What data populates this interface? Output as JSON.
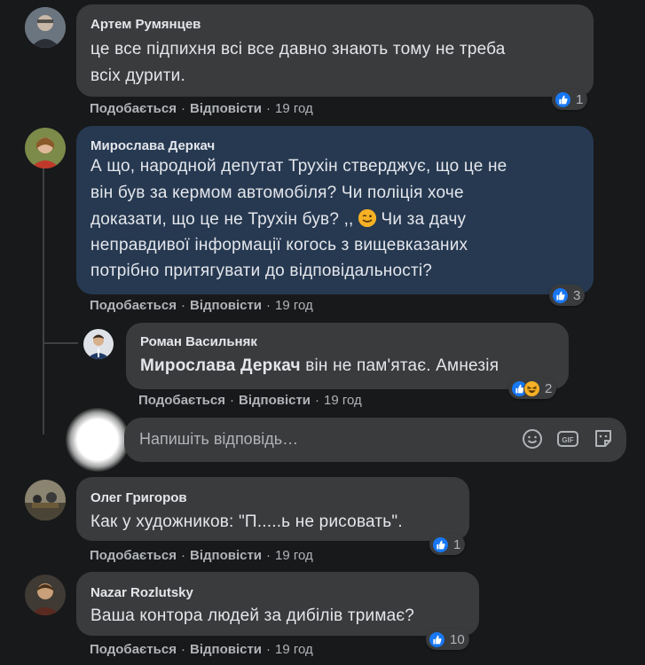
{
  "comments": [
    {
      "author": "Артем Румянцев",
      "text_lines": [
        "це все підпихня всі все давно знають тому не треба",
        "всіх дурити."
      ],
      "reaction_count": "1"
    },
    {
      "author": "Мирослава Деркач",
      "text_lines": [
        "А що, народной депутат Трухін стверджує, що це не",
        "він був за кермом автомобіля? Чи поліція хоче",
        "доказати, що це не Трухін був? ,,",
        "неправдивої інформації когось з вищевказаних",
        "потрібно притягувати до відповідальності?"
      ],
      "line3_suffix": " Чи за дачу",
      "reaction_count": "3"
    },
    {
      "author": "Роман Васильняк",
      "mention": "Мирослава Деркач",
      "text": " він не пам'ятає. Амнезія",
      "reaction_count": "2"
    },
    {
      "author": "Олег Григоров",
      "text": "Как у художников: \"П.....ь не рисовать\".",
      "reaction_count": "1"
    },
    {
      "author": "Nazar Rozlutsky",
      "text": "Ваша контора людей за дибілів тримає?",
      "reaction_count": "10"
    }
  ],
  "meta": {
    "like": "Подобається",
    "reply": "Відповісти",
    "separator": "·",
    "time": "19 год"
  },
  "reply_box": {
    "placeholder": "Напишіть відповідь…"
  },
  "icons": {
    "like": "like-icon",
    "haha": "haha-icon",
    "emoji": "emoji-icon",
    "gif": "gif-icon",
    "sticker": "sticker-icon"
  }
}
